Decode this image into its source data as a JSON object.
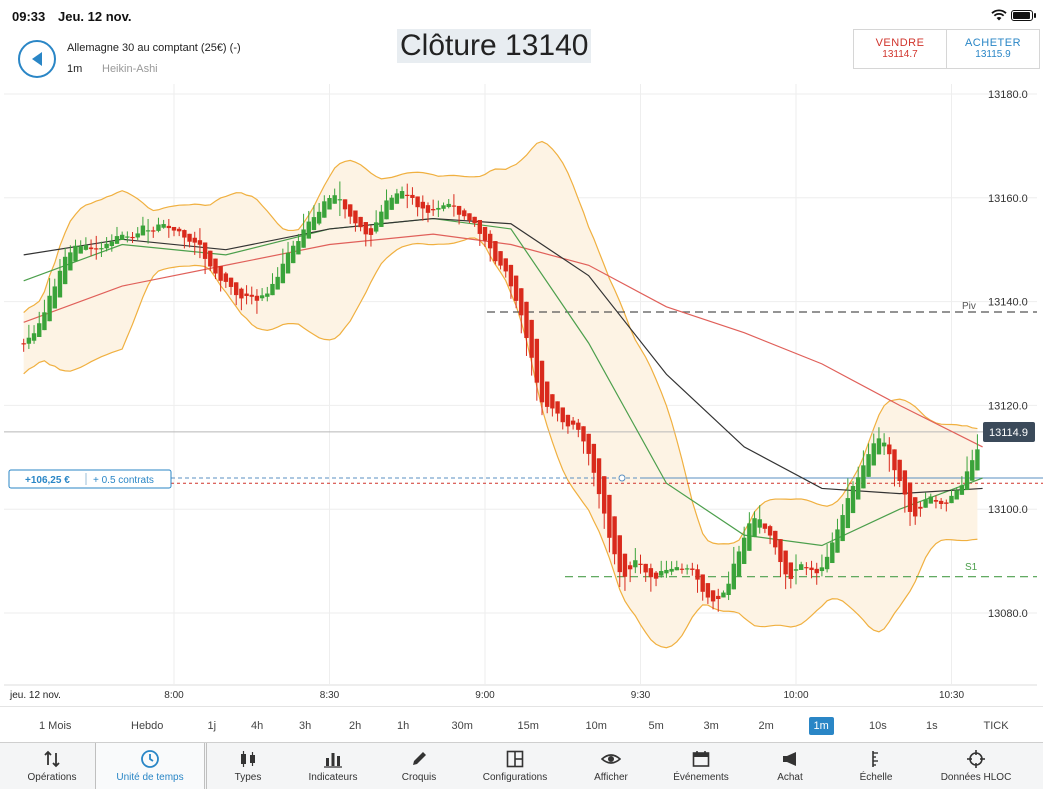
{
  "status_bar": {
    "time": "09:33",
    "date": "Jeu. 12 nov."
  },
  "header": {
    "instrument": "Allemagne 30 au comptant (25€) (-)",
    "timeframe": "1m",
    "chart_type": "Heikin-Ashi",
    "close_label": "Clôture 13140"
  },
  "trade": {
    "sell_label": "VENDRE",
    "sell_price": "13114.7",
    "buy_label": "ACHETER",
    "buy_price": "13115.9"
  },
  "colors": {
    "accent": "#2a86c6",
    "sell": "#d0342c",
    "bull_candle": "#3aa33a",
    "bear_candle": "#d92a1c",
    "bollinger": "#f0b040",
    "bollinger_fill": "#fdf3e4",
    "ma_red": "#e0605a",
    "ma_green": "#4c9f4c",
    "ma_black": "#333333"
  },
  "chart": {
    "position_pnl": "+106,25 €",
    "position_size": "+ 0.5 contrats",
    "current_price_tag": "13114.9",
    "date_label": "jeu. 12 nov.",
    "pivot_label": "Piv",
    "s1_label": "S1"
  },
  "chart_data": {
    "type": "candlestick",
    "style": "Heikin-Ashi",
    "interval": "1m",
    "y_ticks": [
      "13180.0",
      "13160.0",
      "13140.0",
      "13120.0",
      "13100.0",
      "13080.0"
    ],
    "y_tick_values": [
      13180,
      13160,
      13140,
      13120,
      13100,
      13080
    ],
    "x_ticks": [
      "8:00",
      "8:30",
      "9:00",
      "9:30",
      "10:00",
      "10:30"
    ],
    "x_tick_minutes": [
      480,
      510,
      540,
      570,
      600,
      630
    ],
    "time_range_minutes": [
      451,
      646
    ],
    "ylim": [
      13063,
      13200
    ],
    "grid": true,
    "pivot_level": 13138,
    "s1_level": 13087,
    "current_price": 13114.9,
    "entry_level": 13106,
    "sell_level": 13105,
    "close_path": [
      [
        451,
        13132
      ],
      [
        454,
        13137
      ],
      [
        457,
        13145
      ],
      [
        460,
        13151
      ],
      [
        463,
        13150
      ],
      [
        466,
        13151
      ],
      [
        469,
        13153
      ],
      [
        472,
        13153
      ],
      [
        475,
        13154
      ],
      [
        478,
        13155
      ],
      [
        481,
        13153
      ],
      [
        484,
        13151
      ],
      [
        487,
        13146
      ],
      [
        490,
        13143
      ],
      [
        493,
        13141
      ],
      [
        496,
        13140
      ],
      [
        499,
        13144
      ],
      [
        502,
        13150
      ],
      [
        505,
        13155
      ],
      [
        508,
        13159
      ],
      [
        511,
        13160
      ],
      [
        514,
        13156
      ],
      [
        517,
        13152
      ],
      [
        520,
        13159
      ],
      [
        523,
        13162
      ],
      [
        526,
        13158
      ],
      [
        529,
        13156
      ],
      [
        532,
        13160
      ],
      [
        535,
        13157
      ],
      [
        538,
        13154
      ],
      [
        541,
        13149
      ],
      [
        544,
        13145
      ],
      [
        547,
        13135
      ],
      [
        550,
        13122
      ],
      [
        553,
        13118
      ],
      [
        556,
        13117
      ],
      [
        559,
        13112
      ],
      [
        561,
        13105
      ],
      [
        563,
        13097
      ],
      [
        566,
        13087
      ],
      [
        569,
        13090
      ],
      [
        572,
        13087
      ],
      [
        575,
        13089
      ],
      [
        578,
        13089
      ],
      [
        580,
        13088
      ],
      [
        583,
        13082
      ],
      [
        586,
        13085
      ],
      [
        589,
        13094
      ],
      [
        592,
        13099
      ],
      [
        595,
        13093
      ],
      [
        598,
        13087
      ],
      [
        601,
        13090
      ],
      [
        604,
        13088
      ],
      [
        607,
        13095
      ],
      [
        610,
        13103
      ],
      [
        613,
        13110
      ],
      [
        616,
        13114
      ],
      [
        619,
        13106
      ],
      [
        622,
        13098
      ],
      [
        625,
        13102
      ],
      [
        628,
        13100
      ],
      [
        631,
        13104
      ],
      [
        634,
        13110
      ],
      [
        636,
        13114
      ]
    ],
    "ma_red": [
      [
        451,
        13136
      ],
      [
        470,
        13143
      ],
      [
        490,
        13147
      ],
      [
        510,
        13151
      ],
      [
        530,
        13153
      ],
      [
        545,
        13151
      ],
      [
        560,
        13147
      ],
      [
        575,
        13139
      ],
      [
        590,
        13134
      ],
      [
        605,
        13128
      ],
      [
        620,
        13120
      ],
      [
        636,
        13112
      ]
    ],
    "ma_green": [
      [
        451,
        13144
      ],
      [
        470,
        13151
      ],
      [
        490,
        13149
      ],
      [
        510,
        13154
      ],
      [
        530,
        13156
      ],
      [
        545,
        13154
      ],
      [
        560,
        13132
      ],
      [
        575,
        13105
      ],
      [
        590,
        13095
      ],
      [
        605,
        13093
      ],
      [
        620,
        13100
      ],
      [
        636,
        13106
      ]
    ],
    "ma_black": [
      [
        451,
        13149
      ],
      [
        470,
        13152
      ],
      [
        490,
        13150
      ],
      [
        510,
        13154
      ],
      [
        530,
        13156
      ],
      [
        545,
        13155
      ],
      [
        560,
        13145
      ],
      [
        575,
        13126
      ],
      [
        590,
        13112
      ],
      [
        605,
        13104
      ],
      [
        620,
        13103
      ],
      [
        636,
        13104
      ]
    ]
  },
  "timeframes": [
    {
      "label": "1 Mois",
      "active": false
    },
    {
      "label": "Hebdo",
      "active": false
    },
    {
      "label": "1j",
      "active": false
    },
    {
      "label": "4h",
      "active": false
    },
    {
      "label": "3h",
      "active": false
    },
    {
      "label": "2h",
      "active": false
    },
    {
      "label": "1h",
      "active": false
    },
    {
      "label": "30m",
      "active": false
    },
    {
      "label": "15m",
      "active": false
    },
    {
      "label": "10m",
      "active": false
    },
    {
      "label": "5m",
      "active": false
    },
    {
      "label": "3m",
      "active": false
    },
    {
      "label": "2m",
      "active": false
    },
    {
      "label": "1m",
      "active": true
    },
    {
      "label": "10s",
      "active": false
    },
    {
      "label": "1s",
      "active": false
    },
    {
      "label": "TICK",
      "active": false
    }
  ],
  "toolbar": [
    {
      "label": "Opérations",
      "icon": "arrows-updown-icon"
    },
    {
      "label": "Unité de temps",
      "icon": "clock-icon",
      "active": true
    },
    {
      "label": "Types",
      "icon": "candles-icon"
    },
    {
      "label": "Indicateurs",
      "icon": "bar-chart-icon"
    },
    {
      "label": "Croquis",
      "icon": "pencil-icon"
    },
    {
      "label": "Configurations",
      "icon": "layout-icon"
    },
    {
      "label": "Afficher",
      "icon": "eye-icon"
    },
    {
      "label": "Événements",
      "icon": "calendar-icon"
    },
    {
      "label": "Achat",
      "icon": "megaphone-icon"
    },
    {
      "label": "Échelle",
      "icon": "scale-icon"
    },
    {
      "label": "Données HLOC",
      "icon": "crosshair-icon"
    }
  ]
}
